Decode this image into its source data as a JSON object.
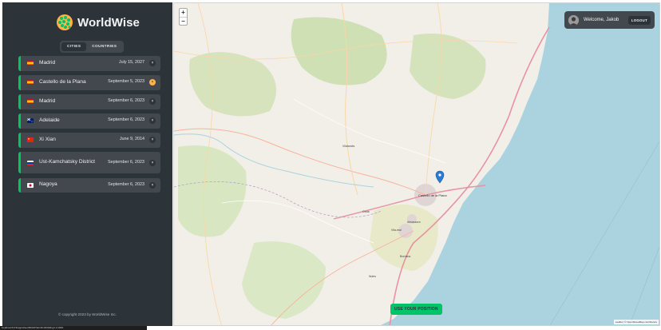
{
  "app": {
    "name": "WorldWise",
    "tabs": [
      {
        "label": "CITIES",
        "active": true
      },
      {
        "label": "COUNTRIES",
        "active": false
      }
    ],
    "cities": [
      {
        "flag": "spain",
        "name": "Madrid",
        "date": "July 15, 2027",
        "delete": "×"
      },
      {
        "flag": "spain",
        "name": "Castello de la Plana",
        "date": "September 5, 2023",
        "delete": "×",
        "active": true
      },
      {
        "flag": "spain",
        "name": "Madrid",
        "date": "September 6, 2023",
        "delete": "×"
      },
      {
        "flag": "australia",
        "name": "Adelaide",
        "date": "September 6, 2023",
        "delete": "×"
      },
      {
        "flag": "china",
        "name": "Xi Xian",
        "date": "June 9, 2014",
        "delete": "×"
      },
      {
        "flag": "russia",
        "name": "Ust-Kamchatsky District",
        "date": "September 6, 2023",
        "delete": "×"
      },
      {
        "flag": "japan",
        "name": "Nagoya",
        "date": "September 6, 2023",
        "delete": "×"
      }
    ],
    "copyright": "© copyright 2023 by WorldWise Inc."
  },
  "map": {
    "zoom_in": "+",
    "zoom_out": "−",
    "user": {
      "welcome": "Welcome, Jakob",
      "logout": "LOGOUT"
    },
    "use_position": "USE YOUR POSITION",
    "attribution": "Leaflet | © OpenStreetMap contributors",
    "labels": {
      "castello": "Castelló de la Plana",
      "vila_real": "Vila-real",
      "borriana": "Borriana",
      "almassora": "Almassora",
      "onda": "Onda",
      "nules": "Nules",
      "vilafames": "Vilafamés"
    }
  },
  "colors": {
    "brand": "#00c46a",
    "accent": "#ffb545",
    "sidebar": "#2d3439",
    "panel": "#42484d",
    "sea": "#aad3df"
  },
  "statusbar": {
    "text": "localhost:5173/app/cities/60323?lat=40.0033&lng=-0.0281"
  }
}
